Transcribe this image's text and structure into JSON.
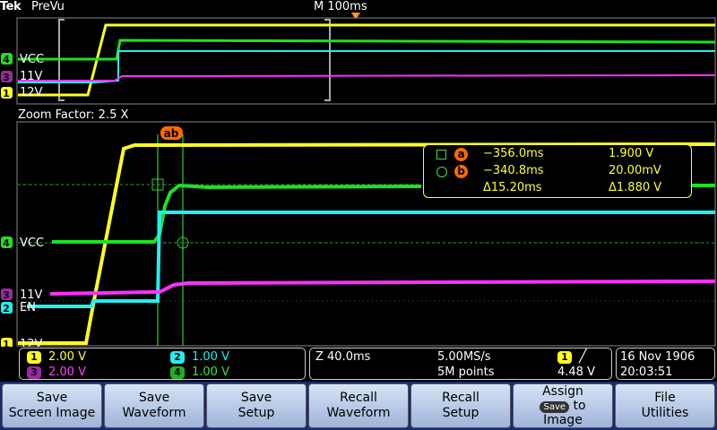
{
  "header": {
    "brand": "Tek",
    "mode": "PreVu",
    "timebase": "M 100ms"
  },
  "zoom": {
    "label": "Zoom Factor: 2.5 X"
  },
  "channels": [
    {
      "num": "1",
      "name": "12V",
      "scale": "2.00 V",
      "color": "#ffff20"
    },
    {
      "num": "2",
      "name": "EN",
      "scale": "1.00 V",
      "color": "#20f0f0"
    },
    {
      "num": "3",
      "name": "11V",
      "scale": "2.00 V",
      "color": "#ff30ff"
    },
    {
      "num": "4",
      "name": "VCC",
      "scale": "1.00 V",
      "color": "#20e020"
    }
  ],
  "cursors": {
    "label": "ab",
    "a": {
      "tag": "a",
      "time": "−356.0ms",
      "value": "1.900 V"
    },
    "b": {
      "tag": "b",
      "time": "−340.8ms",
      "value": "20.00mV"
    },
    "delta": {
      "time": "Δ15.20ms",
      "value": "Δ1.880 V"
    }
  },
  "acquisition": {
    "zoom_time": "Z 40.0ms",
    "sample_rate": "5.00MS/s",
    "record_length": "5M points",
    "trigger_source": "1",
    "trigger_slope_icon": "rising-edge-icon",
    "trigger_level": "4.48 V"
  },
  "datetime": {
    "date": "16 Nov 1906",
    "time": "20:03:51"
  },
  "menu": {
    "save_screen_image": [
      "Save",
      "Screen Image"
    ],
    "save_waveform": [
      "Save",
      "Waveform"
    ],
    "save_setup": [
      "Save",
      "Setup"
    ],
    "recall_waveform": [
      "Recall",
      "Waveform"
    ],
    "recall_setup": [
      "Recall",
      "Setup"
    ],
    "assign_save": {
      "top": "Assign",
      "chip": "Save",
      "mid": "to",
      "bottom": "Image"
    },
    "file_utilities": [
      "File",
      "Utilities"
    ]
  }
}
